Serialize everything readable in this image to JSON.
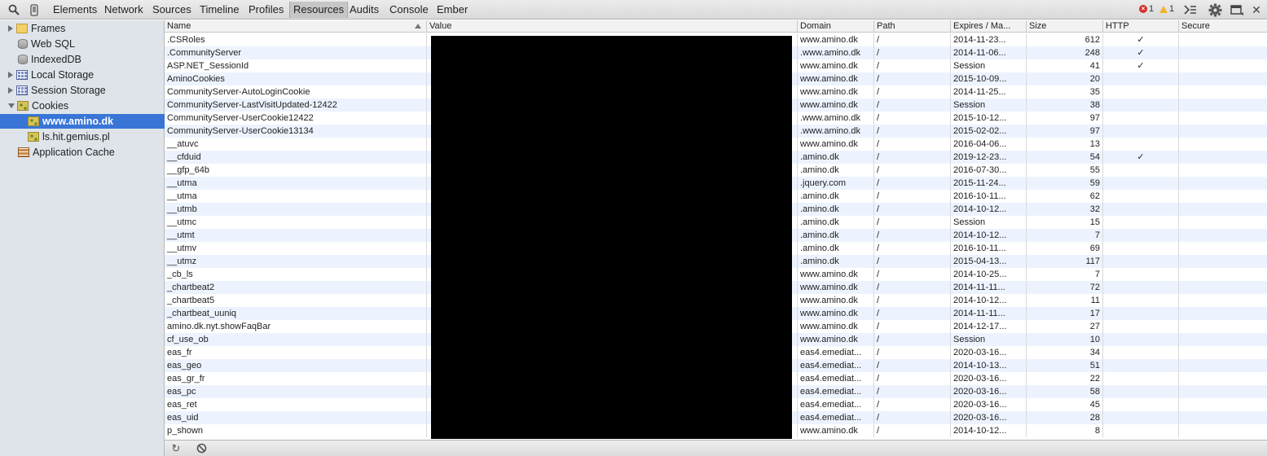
{
  "toolbar": {
    "tabs": [
      "Elements",
      "Network",
      "Sources",
      "Timeline",
      "Profiles",
      "Resources",
      "Audits",
      "Console",
      "Ember"
    ],
    "selected_tab": "Resources",
    "error_count": "1",
    "warning_count": "1"
  },
  "sidebar": {
    "items": [
      {
        "label": "Frames",
        "icon": "folder-icon"
      },
      {
        "label": "Web SQL",
        "icon": "database-icon"
      },
      {
        "label": "IndexedDB",
        "icon": "database-icon"
      },
      {
        "label": "Local Storage",
        "icon": "storage-grid-icon"
      },
      {
        "label": "Session Storage",
        "icon": "storage-grid-icon"
      },
      {
        "label": "Cookies",
        "icon": "cookie-icon"
      },
      {
        "label": "www.amino.dk",
        "icon": "cookie-icon"
      },
      {
        "label": "ls.hit.gemius.pl",
        "icon": "cookie-icon"
      },
      {
        "label": "Application Cache",
        "icon": "cache-grid-icon"
      }
    ]
  },
  "table": {
    "columns": [
      "Name",
      "Value",
      "Domain",
      "Path",
      "Expires / Ma...",
      "Size",
      "HTTP",
      "Secure"
    ],
    "rows": [
      [
        ".CSRoles",
        "www.amino.dk",
        "/",
        "2014-11-23...",
        "612",
        "✓",
        ""
      ],
      [
        ".CommunityServer",
        ".www.amino.dk",
        "/",
        "2014-11-06...",
        "248",
        "✓",
        ""
      ],
      [
        "ASP.NET_SessionId",
        "www.amino.dk",
        "/",
        "Session",
        "41",
        "✓",
        ""
      ],
      [
        "AminoCookies",
        "www.amino.dk",
        "/",
        "2015-10-09...",
        "20",
        "",
        ""
      ],
      [
        "CommunityServer-AutoLoginCookie",
        "www.amino.dk",
        "/",
        "2014-11-25...",
        "35",
        "",
        ""
      ],
      [
        "CommunityServer-LastVisitUpdated-12422",
        "www.amino.dk",
        "/",
        "Session",
        "38",
        "",
        ""
      ],
      [
        "CommunityServer-UserCookie12422",
        ".www.amino.dk",
        "/",
        "2015-10-12...",
        "97",
        "",
        ""
      ],
      [
        "CommunityServer-UserCookie13134",
        ".www.amino.dk",
        "/",
        "2015-02-02...",
        "97",
        "",
        ""
      ],
      [
        "__atuvc",
        "www.amino.dk",
        "/",
        "2016-04-06...",
        "13",
        "",
        ""
      ],
      [
        "__cfduid",
        ".amino.dk",
        "/",
        "2019-12-23...",
        "54",
        "✓",
        ""
      ],
      [
        "__gfp_64b",
        ".amino.dk",
        "/",
        "2016-07-30...",
        "55",
        "",
        ""
      ],
      [
        "__utma",
        ".jquery.com",
        "/",
        "2015-11-24...",
        "59",
        "",
        ""
      ],
      [
        "__utma",
        ".amino.dk",
        "/",
        "2016-10-11...",
        "62",
        "",
        ""
      ],
      [
        "__utmb",
        ".amino.dk",
        "/",
        "2014-10-12...",
        "32",
        "",
        ""
      ],
      [
        "__utmc",
        ".amino.dk",
        "/",
        "Session",
        "15",
        "",
        ""
      ],
      [
        "__utmt",
        ".amino.dk",
        "/",
        "2014-10-12...",
        "7",
        "",
        ""
      ],
      [
        "__utmv",
        ".amino.dk",
        "/",
        "2016-10-11...",
        "69",
        "",
        ""
      ],
      [
        "__utmz",
        ".amino.dk",
        "/",
        "2015-04-13...",
        "117",
        "",
        ""
      ],
      [
        "_cb_ls",
        "www.amino.dk",
        "/",
        "2014-10-25...",
        "7",
        "",
        ""
      ],
      [
        "_chartbeat2",
        "www.amino.dk",
        "/",
        "2014-11-11...",
        "72",
        "",
        ""
      ],
      [
        "_chartbeat5",
        "www.amino.dk",
        "/",
        "2014-10-12...",
        "11",
        "",
        ""
      ],
      [
        "_chartbeat_uuniq",
        "www.amino.dk",
        "/",
        "2014-11-11...",
        "17",
        "",
        ""
      ],
      [
        "amino.dk.nyt.showFaqBar",
        "www.amino.dk",
        "/",
        "2014-12-17...",
        "27",
        "",
        ""
      ],
      [
        "cf_use_ob",
        "www.amino.dk",
        "/",
        "Session",
        "10",
        "",
        ""
      ],
      [
        "eas_fr",
        "eas4.emediat...",
        "/",
        "2020-03-16...",
        "34",
        "",
        ""
      ],
      [
        "eas_geo",
        "eas4.emediat...",
        "/",
        "2014-10-13...",
        "51",
        "",
        ""
      ],
      [
        "eas_gr_fr",
        "eas4.emediat...",
        "/",
        "2020-03-16...",
        "22",
        "",
        ""
      ],
      [
        "eas_pc",
        "eas4.emediat...",
        "/",
        "2020-03-16...",
        "58",
        "",
        ""
      ],
      [
        "eas_ret",
        "eas4.emediat...",
        "/",
        "2020-03-16...",
        "45",
        "",
        ""
      ],
      [
        "eas_uid",
        "eas4.emediat...",
        "/",
        "2020-03-16...",
        "28",
        "",
        ""
      ],
      [
        "p_shown",
        "www.amino.dk",
        "/",
        "2014-10-12...",
        "8",
        "",
        ""
      ]
    ]
  }
}
